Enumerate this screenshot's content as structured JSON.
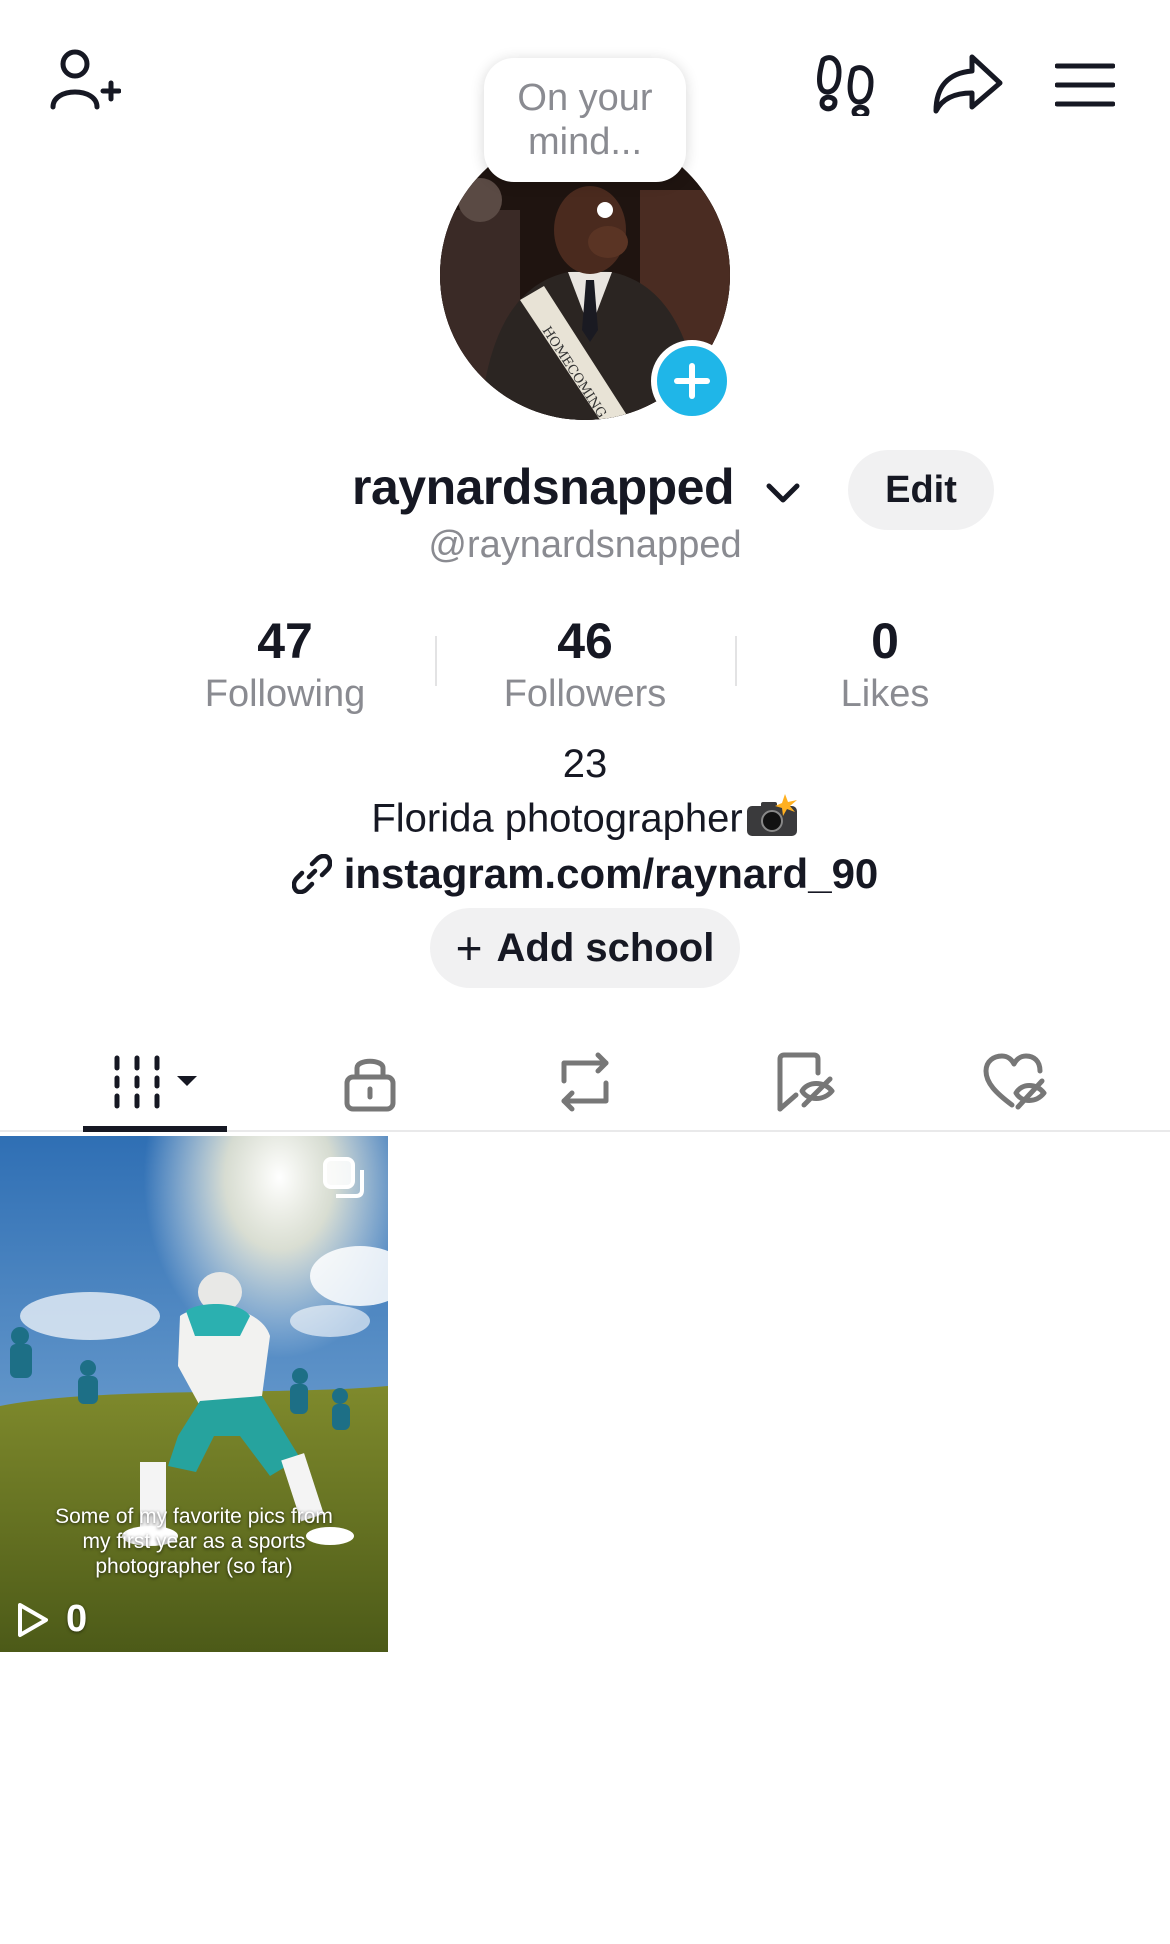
{
  "header": {
    "thought_bubble": "On your mind..."
  },
  "profile": {
    "username": "raynardsnapped",
    "handle": "@raynardsnapped",
    "edit_label": "Edit"
  },
  "stats": [
    {
      "value": "47",
      "label": "Following"
    },
    {
      "value": "46",
      "label": "Followers"
    },
    {
      "value": "0",
      "label": "Likes"
    }
  ],
  "bio": {
    "line1": "23",
    "line2": "Florida photographer",
    "link": "instagram.com/raynard_90",
    "add_school": "Add school"
  },
  "tabs": [
    {
      "icon": "grid-icon",
      "active": true
    },
    {
      "icon": "lock-icon",
      "active": false
    },
    {
      "icon": "repost-icon",
      "active": false
    },
    {
      "icon": "bookmark-hidden-icon",
      "active": false
    },
    {
      "icon": "heart-hidden-icon",
      "active": false
    }
  ],
  "videos": [
    {
      "caption": "Some of my favorite pics from my first year as a sports photographer (so far)",
      "views": "0"
    }
  ],
  "colors": {
    "accent": "#1fb6e8",
    "text": "#161823",
    "muted": "#8a8b91",
    "button_bg": "#f1f1f2"
  }
}
